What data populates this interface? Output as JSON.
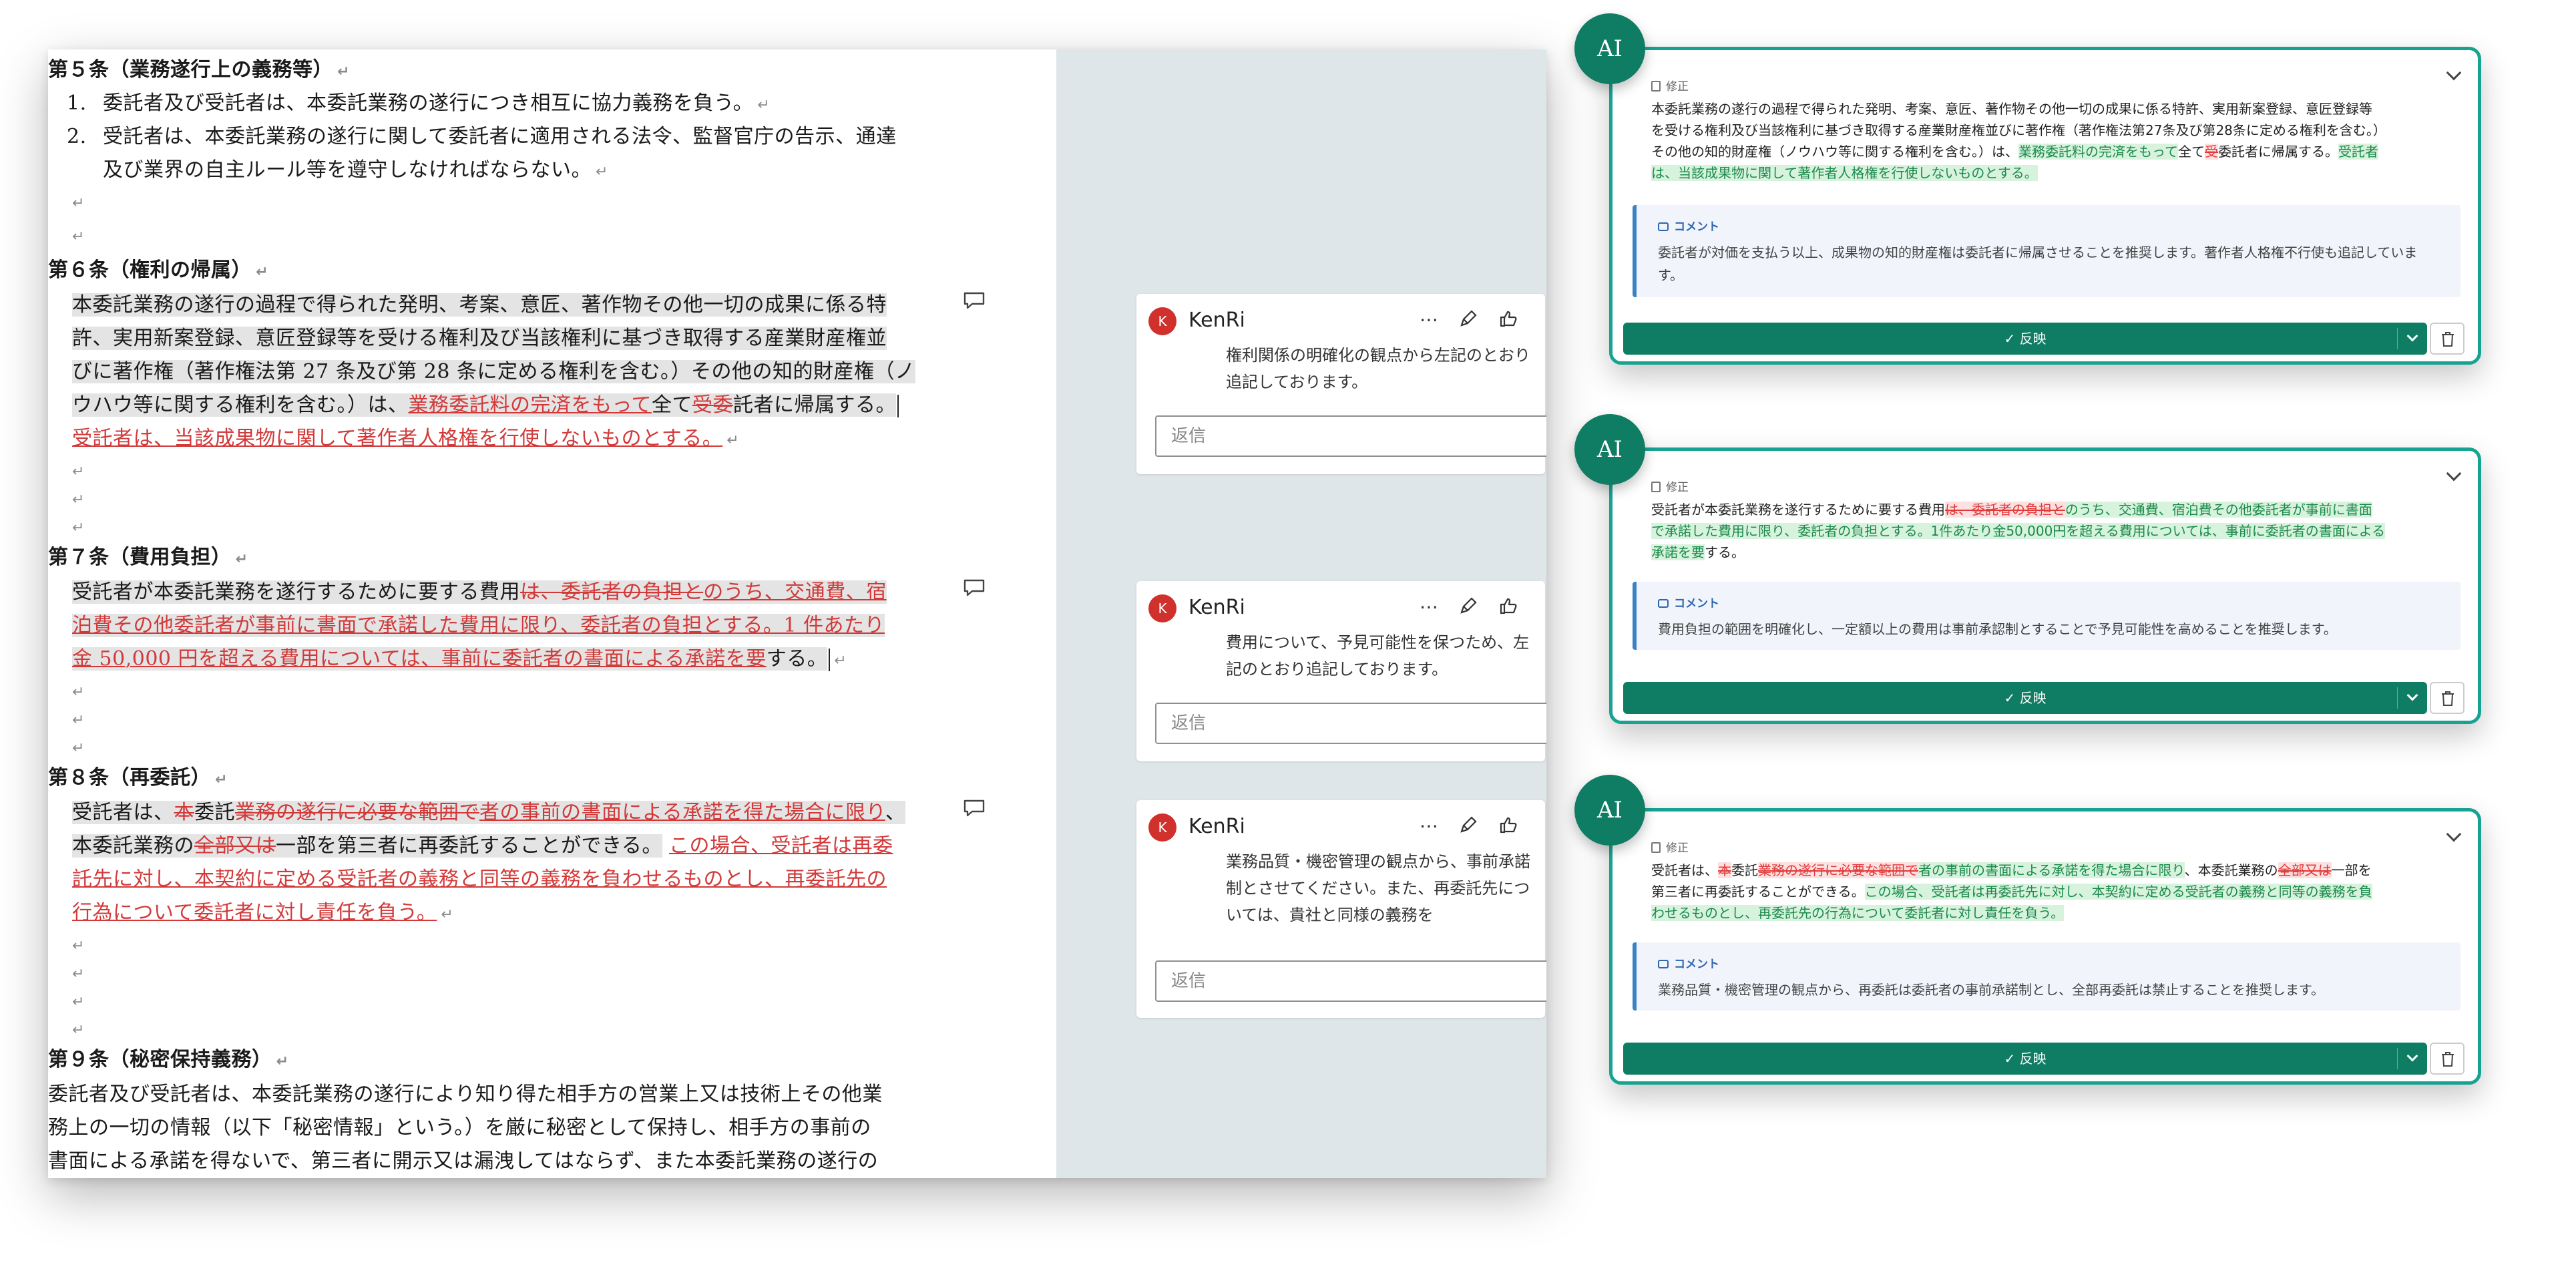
{
  "document": {
    "art5_heading": "第５条（業務遂行上の義務等）",
    "art5_item1_num": "1.",
    "art5_item1": "委託者及び受託者は、本委託業務の遂行につき相互に協力義務を負う。",
    "art5_item2_num": "2.",
    "art5_item2_l1": "受託者は、本委託業務の遂行に関して委託者に適用される法令、監督官庁の告示、通達",
    "art5_item2_l2": "及び業界の自主ルール等を遵守しなければならない。",
    "art6_heading": "第６条（権利の帰属）",
    "art6_l1": "本委託業務の遂行の過程で得られた発明、考案、意匠、著作物その他一切の成果に係る特",
    "art6_l2": "許、実用新案登録、意匠登録等を受ける権利及び当該権利に基づき取得する産業財産権並",
    "art6_l3": "びに著作権（著作権法第 27 条及び第 28 条に定める権利を含む。）その他の知的財産権（ノ",
    "art6_l4a": "ウハウ等に関する権利を含む。）は、",
    "art6_l4_ins": "業務委託料の完済をもって",
    "art6_l4b": "全て",
    "art6_l4_del": "受委",
    "art6_l4c": "託者に帰属する。",
    "art6_l5_ins": "受託者は、当該成果物に関して著作者人格権を行使しないものとする。",
    "art7_heading": "第７条（費用負担）",
    "art7_l1a": "受託者が本委託業務を遂行するために要する費用",
    "art7_l1_del": "は、委託者の負担と",
    "art7_l1_ins": "のうち、交通費、宿",
    "art7_l2_ins": "泊費その他委託者が事前に書面で承諾した費用に限り、委託者の負担とする。1 件あたり",
    "art7_l3_ins": "金 50,000 円を超える費用については、事前に委託者の書面による承諾を要",
    "art7_l3b": "する。",
    "art8_heading": "第８条（再委託）",
    "art8_l1a": "受託者は、",
    "art8_l1_del1": "本",
    "art8_l1b": "委託",
    "art8_l1_del2": "業務の遂行に必要な範囲で",
    "art8_l1_ins": "者の事前の書面による承諾を得た場合に限り",
    "art8_l1c": "、",
    "art8_l2a": "本委託業務の",
    "art8_l2_del": "全部又は",
    "art8_l2b": "一部を第三者に再委託することができる。",
    "art8_l2_ins": "この場合、受託者は再委",
    "art8_l3_ins": "託先に対し、本契約に定める受託者の義務と同等の義務を負わせるものとし、再委託先の",
    "art8_l4_ins": "行為について委託者に対し責任を負う。",
    "art9_heading": "第９条（秘密保持義務）",
    "art9_l1": "委託者及び受託者は、本委託業務の遂行により知り得た相手方の営業上又は技術上その他業",
    "art9_l2": "務上の一切の情報（以下「秘密情報」という。）を厳に秘密として保持し、相手方の事前の",
    "art9_l3": "書面による承諾を得ないで、第三者に開示又は漏洩してはならず、また本委託業務の遂行の"
  },
  "comments": [
    {
      "avatar": "K",
      "author": "KenRi",
      "text": "権利関係の明確化の観点から左記のとおり追記しております。",
      "reply_placeholder": "返信"
    },
    {
      "avatar": "K",
      "author": "KenRi",
      "text": "費用について、予見可能性を保つため、左記のとおり追記しております。",
      "reply_placeholder": "返信"
    },
    {
      "avatar": "K",
      "author": "KenRi",
      "text": "業務品質・機密管理の観点から、事前承諾制とさせてください。また、再委託先については、貴社と同様の義務を",
      "reply_placeholder": "返信"
    }
  ],
  "comment_actions": {
    "more": "⋯",
    "edit_icon": "pencil-icon",
    "like_icon": "thumbs-up-icon"
  },
  "ai_panels": [
    {
      "badge": "AI",
      "edit_label": "修正",
      "edit_text": {
        "p1": "本委託業務の遂行の過程で得られた発明、考案、意匠、著作物その他一切の成果に係る特許、実用新案登録、意匠登録等",
        "p2": "を受ける権利及び当該権利に基づき取得する産業財産権並びに著作権（著作権法第27条及び第28条に定める権利を含む。）",
        "p3a": "その他の知的財産権（ノウハウ等に関する権利を含む。）は、",
        "p3_ins": "業務委託料の完済をもって",
        "p3b": "全て",
        "p3_del": "受",
        "p3c": "委託者に帰属する。",
        "p3_ins2": "受託者",
        "p4_ins": "は、当該成果物に関して著作者人格権を行使しないものとする。"
      },
      "comment_label": "コメント",
      "comment_text": "委託者が対価を支払う以上、成果物の知的財産権は委託者に帰属させることを推奨します。著作者人格権不行使も追記しています。",
      "apply_label": "反映"
    },
    {
      "badge": "AI",
      "edit_label": "修正",
      "edit_text": {
        "p1a": "受託者が本委託業務を遂行するために要する費用",
        "p1_del": "は、委託者の負担と",
        "p1_ins": "のうち、交通費、宿泊費その他委託者が事前に書面",
        "p2_ins": "で承諾した費用に限り、委託者の負担とする。1件あたり金50,000円を超える費用については、事前に委託者の書面による",
        "p3_ins": "承諾を要",
        "p3b": "する。"
      },
      "comment_label": "コメント",
      "comment_text": "費用負担の範囲を明確化し、一定額以上の費用は事前承認制とすることで予見可能性を高めることを推奨します。",
      "apply_label": "反映"
    },
    {
      "badge": "AI",
      "edit_label": "修正",
      "edit_text": {
        "p1a": "受託者は、",
        "p1_del1": "本",
        "p1b": "委託",
        "p1_del2": "業務の遂行に必要な範囲で",
        "p1_ins": "者の事前の書面による承諾を得た場合に限り",
        "p1c": "、本委託業務の",
        "p1_del3": "全部又は",
        "p1d": "一部を",
        "p2a": "第三者に再委託することができる。",
        "p2_ins": "この場合、受託者は再委託先に対し、本契約に定める受託者の義務と同等の義務を負",
        "p3_ins": "わせるものとし、再委託先の行為について委託者に対し責任を負う。"
      },
      "comment_label": "コメント",
      "comment_text": "業務品質・機密管理の観点から、再委託は委託者の事前承諾制とし、全部再委託は禁止することを推奨します。",
      "apply_label": "反映"
    }
  ],
  "colors": {
    "teal": "#0f7d64",
    "panel_border": "#17a392",
    "revision_red": "#d23a3a",
    "insert_green": "#19894a"
  }
}
